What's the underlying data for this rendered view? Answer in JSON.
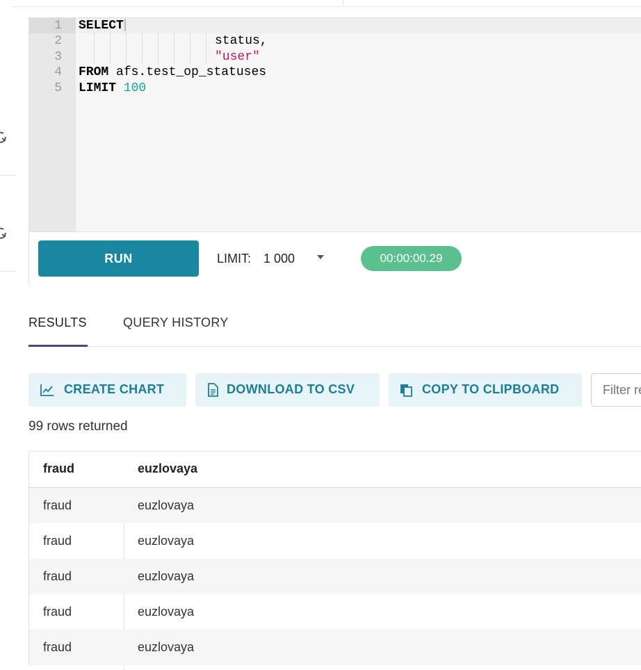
{
  "editor": {
    "line_numbers": [
      "1",
      "2",
      "3",
      "4",
      "5"
    ],
    "lines": {
      "l1_kw": "SELECT",
      "l2_text": "status,",
      "l3_str": "\"user\"",
      "l4_kw": "FROM",
      "l4_text": " afs.test_op_statuses",
      "l5_kw": "LIMIT",
      "l5_num": "100"
    }
  },
  "toolbar": {
    "run_label": "RUN",
    "limit_label": "LIMIT:",
    "limit_value": "1 000",
    "timer": "00:00:00.29"
  },
  "tabs": {
    "results": "RESULTS",
    "query_history": "QUERY HISTORY"
  },
  "actions": {
    "create_chart": "CREATE CHART",
    "download_csv": "DOWNLOAD TO CSV",
    "copy_clipboard": "COPY TO CLIPBOARD",
    "filter_placeholder": "Filter results"
  },
  "rows_returned": "99 rows returned",
  "table": {
    "headers": [
      "fraud",
      "euzlovaya"
    ],
    "rows": [
      [
        "fraud",
        "euzlovaya"
      ],
      [
        "fraud",
        "euzlovaya"
      ],
      [
        "fraud",
        "euzlovaya"
      ],
      [
        "fraud",
        "euzlovaya"
      ],
      [
        "fraud",
        "euzlovaya"
      ]
    ]
  },
  "colors": {
    "run_button": "#1a87a0",
    "timer_badge": "#5ac18e",
    "action_bg": "#e6f4f7",
    "action_text": "#1e7e96",
    "tab_underline": "#414c79"
  },
  "icons": {
    "rail": [
      "refresh-icon",
      "refresh-icon"
    ],
    "create_chart": "line-chart-icon",
    "download_csv": "document-icon",
    "copy_clipboard": "clipboard-icon",
    "limit_dropdown": "caret-down-icon"
  }
}
